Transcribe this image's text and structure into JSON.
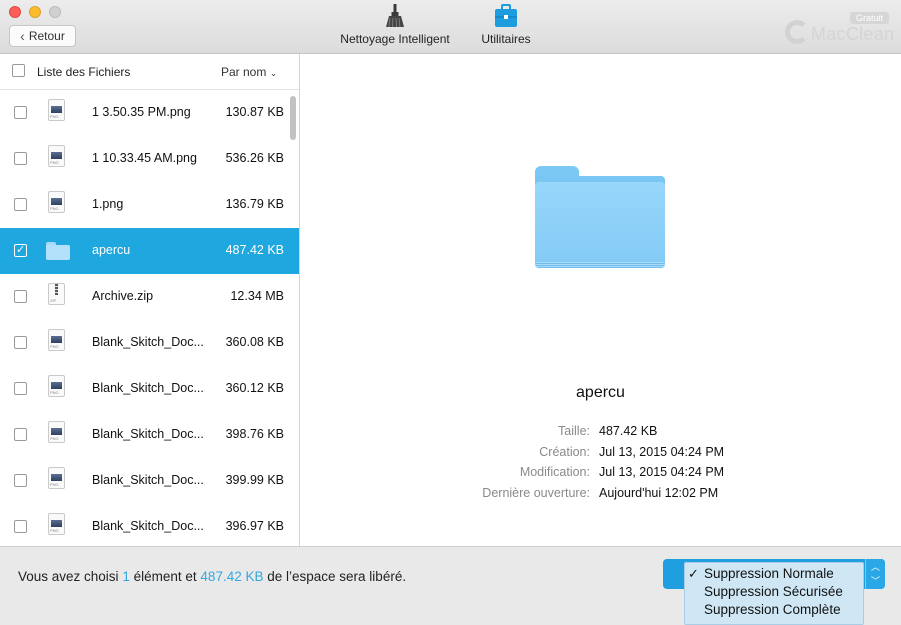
{
  "toolbar": {
    "back_label": "Retour",
    "tools": [
      {
        "label": "Nettoyage Intelligent",
        "icon": "broom-icon"
      },
      {
        "label": "Utilitaires",
        "icon": "toolbox-icon"
      }
    ],
    "brand": {
      "name": "MacClean",
      "badge": "Gratuit"
    }
  },
  "file_list": {
    "header_title": "Liste des Fichiers",
    "sort_label": "Par nom",
    "items": [
      {
        "name": "1 3.50.35 PM.png",
        "size": "130.87 KB",
        "type": "png",
        "checked": false
      },
      {
        "name": "1 10.33.45 AM.png",
        "size": "536.26 KB",
        "type": "png",
        "checked": false
      },
      {
        "name": "1.png",
        "size": "136.79 KB",
        "type": "png",
        "checked": false
      },
      {
        "name": "apercu",
        "size": "487.42 KB",
        "type": "folder",
        "checked": true
      },
      {
        "name": "Archive.zip",
        "size": "12.34 MB",
        "type": "zip",
        "checked": false
      },
      {
        "name": "Blank_Skitch_Doc...",
        "size": "360.08 KB",
        "type": "png",
        "checked": false
      },
      {
        "name": "Blank_Skitch_Doc...",
        "size": "360.12 KB",
        "type": "png",
        "checked": false
      },
      {
        "name": "Blank_Skitch_Doc...",
        "size": "398.76 KB",
        "type": "png",
        "checked": false
      },
      {
        "name": "Blank_Skitch_Doc...",
        "size": "399.99 KB",
        "type": "png",
        "checked": false
      },
      {
        "name": "Blank_Skitch_Doc...",
        "size": "396.97 KB",
        "type": "png",
        "checked": false
      }
    ]
  },
  "detail": {
    "name": "apercu",
    "properties": [
      {
        "label": "Taille:",
        "value": "487.42 KB"
      },
      {
        "label": "Création:",
        "value": "Jul 13, 2015 04:24 PM"
      },
      {
        "label": "Modification:",
        "value": "Jul 13, 2015 04:24 PM"
      },
      {
        "label": "Dernière ouverture:",
        "value": "Aujourd'hui 12:02 PM"
      }
    ]
  },
  "footer": {
    "text_before": "Vous avez choisi",
    "count": "1",
    "text_middle": "élément et",
    "size": "487.42 KB",
    "text_after": "de l’espace sera libéré.",
    "options": [
      {
        "label": "Suppression Normale",
        "selected": true
      },
      {
        "label": "Suppression Sécurisée",
        "selected": false
      },
      {
        "label": "Suppression Complète",
        "selected": false
      }
    ]
  },
  "colors": {
    "accent": "#1fa7e0",
    "highlight_text": "#34a8e0",
    "folder": "#83cbf6"
  }
}
